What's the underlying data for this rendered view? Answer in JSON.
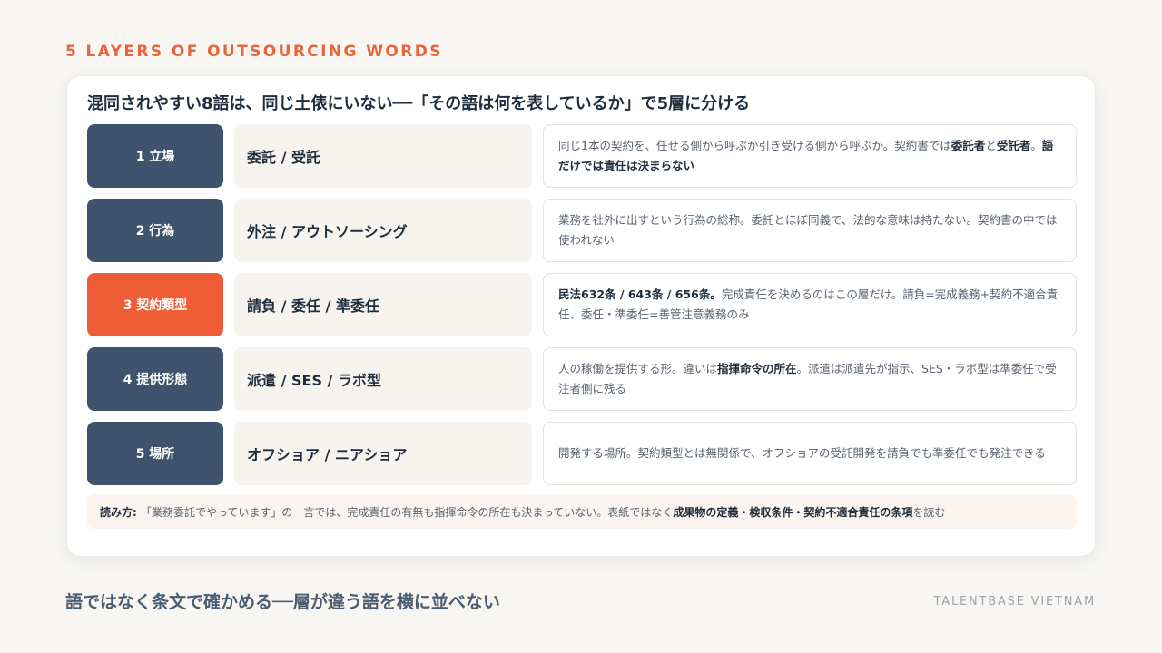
{
  "kicker": "5 LAYERS OF OUTSOURCING WORDS",
  "title": "混同されやすい8語は、同じ土俵にいない──「その語は何を表しているか」で5層に分ける",
  "layers": [
    {
      "label": "1 立場",
      "terms": "委託 / 受託",
      "desc_parts": [
        {
          "text": "同じ1本の契約を、任せる側から呼ぶか引き受ける側から呼ぶか。契約書では"
        },
        {
          "text": "委託者",
          "bold": true
        },
        {
          "text": "と"
        },
        {
          "text": "受託者",
          "bold": true
        },
        {
          "text": "。"
        },
        {
          "text": "語だけでは責任は決まらない",
          "bold": true
        }
      ]
    },
    {
      "label": "2 行為",
      "terms": "外注 / アウトソーシング",
      "desc_parts": [
        {
          "text": "業務を社外に出すという行為の総称。委託とほぼ同義で、法的な意味は持たない。契約書の中では使われない"
        }
      ]
    },
    {
      "label": "3 契約類型",
      "terms": "請負 / 委任 / 準委任",
      "accent": true,
      "desc_parts": [
        {
          "text": "民法632条 / 643条 / 656条。",
          "bold": true
        },
        {
          "text": "完成責任を決めるのはこの層だけ。請負=完成義務+契約不適合責任、委任・準委任=善管注意義務のみ"
        }
      ]
    },
    {
      "label": "4 提供形態",
      "terms": "派遣 / SES / ラボ型",
      "desc_parts": [
        {
          "text": "人の稼働を提供する形。違いは"
        },
        {
          "text": "指揮命令の所在",
          "bold": true
        },
        {
          "text": "。派遣は派遣先が指示、SES・ラボ型は準委任で受注者側に残る"
        }
      ]
    },
    {
      "label": "5 場所",
      "terms": "オフショア / ニアショア",
      "desc_parts": [
        {
          "text": "開発する場所。契約類型とは無関係で、オフショアの受託開発を請負でも準委任でも発注できる"
        }
      ]
    }
  ],
  "note_parts": [
    {
      "text": "読み方: ",
      "bold": true
    },
    {
      "text": "「業務委託でやっています」の一言では、完成責任の有無も指揮命令の所在も決まっていない。表紙ではなく"
    },
    {
      "text": "成果物の定義・検収条件・契約不適合責任の条項",
      "bold": true
    },
    {
      "text": "を読む"
    }
  ],
  "footer_message": "語ではなく条文で確かめる──層が違う語を横に並べない",
  "brand": "TALENTBASE VIETNAM",
  "colors": {
    "accent": "#ee5d35",
    "layer_box": "#3e536d",
    "kicker": "#e8643a"
  }
}
